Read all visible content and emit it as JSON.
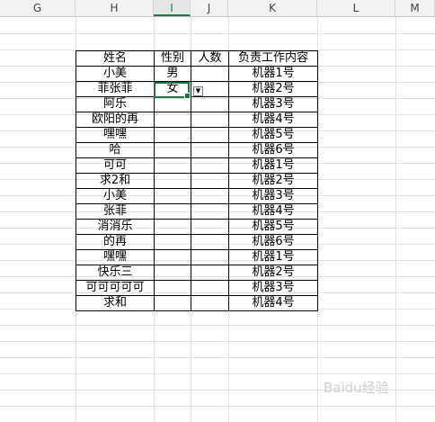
{
  "columns": [
    "G",
    "H",
    "I",
    "J",
    "K",
    "L",
    "M"
  ],
  "active_column": "I",
  "table": {
    "headers": [
      "姓名",
      "性别",
      "人数",
      "负责工作内容"
    ],
    "rows": [
      [
        "小美",
        "男",
        "",
        "机器1号"
      ],
      [
        "菲张菲",
        "女",
        "",
        "机器2号"
      ],
      [
        "阿乐",
        "",
        "",
        "机器3号"
      ],
      [
        "欧阳的再",
        "",
        "",
        "机器4号"
      ],
      [
        "嘿嘿",
        "",
        "",
        "机器5号"
      ],
      [
        "哈",
        "",
        "",
        "机器6号"
      ],
      [
        "可可",
        "",
        "",
        "机器1号"
      ],
      [
        "求2和",
        "",
        "",
        "机器2号"
      ],
      [
        "小美",
        "",
        "",
        "机器3号"
      ],
      [
        "张菲",
        "",
        "",
        "机器4号"
      ],
      [
        "消消乐",
        "",
        "",
        "机器5号"
      ],
      [
        "的再",
        "",
        "",
        "机器6号"
      ],
      [
        "嘿嘿",
        "",
        "",
        "机器1号"
      ],
      [
        "快乐三",
        "",
        "",
        "机器2号"
      ],
      [
        "可可可可可",
        "",
        "",
        "机器3号"
      ],
      [
        "求和",
        "",
        "",
        "机器4号"
      ]
    ]
  },
  "watermark": "Baidu经验",
  "colors": {
    "selection": "#217346",
    "border": "#000000",
    "gridline": "#e1e1e1"
  }
}
